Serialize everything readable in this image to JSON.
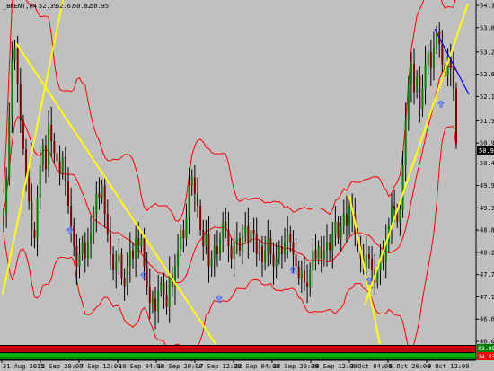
{
  "header": {
    "symbol": "_BRENT,H4",
    "open": "52.39",
    "high": "52.67",
    "low": "50.82",
    "close": "50.95"
  },
  "colors": {
    "background": "#c0c0c0",
    "bull_candle": "#008000",
    "bear_candle": "#800000",
    "wick": "#000000",
    "bands": "#ff0000",
    "trendlines": "#ffff00",
    "channel": "#0000ff",
    "price_tag_bg": "#000000",
    "indicator_tag_green": "#008000",
    "indicator_tag_red": "#ff0000"
  },
  "chart_data": {
    "type": "candlestick",
    "title": "_BRENT,H4",
    "y_ticks": [
      "54.35",
      "53.80",
      "53.20",
      "52.65",
      "52.10",
      "51.50",
      "50.95",
      "50.45",
      "49.90",
      "49.35",
      "48.80",
      "48.25",
      "47.70",
      "47.15",
      "46.60",
      "46.05"
    ],
    "x_ticks": [
      "31 Aug 2015",
      "2 Sep 20:00",
      "7 Sep 12:00",
      "10 Sep 04:00",
      "14 Sep 20:00",
      "17 Sep 12:00",
      "22 Sep 04:00",
      "24 Sep 20:00",
      "29 Sep 12:00",
      "2 Oct 04:00",
      "6 Oct 20:00",
      "9 Oct 12:00"
    ],
    "ylim": [
      46.05,
      54.6
    ],
    "current_price": "50.95",
    "indicator_values": [
      "83.8926",
      "24.8322"
    ],
    "closes": [
      49.2,
      50.1,
      51.6,
      53.0,
      53.3,
      52.4,
      51.5,
      50.8,
      50.1,
      49.5,
      48.8,
      48.6,
      49.6,
      50.4,
      50.9,
      50.3,
      51.4,
      51.0,
      50.7,
      50.5,
      50.2,
      50.6,
      50.0,
      49.4,
      48.9,
      48.4,
      47.9,
      48.2,
      48.5,
      48.1,
      48.5,
      48.7,
      49.2,
      49.7,
      49.6,
      49.9,
      49.2,
      48.7,
      48.2,
      47.8,
      48.0,
      48.2,
      47.6,
      47.4,
      47.9,
      48.3,
      48.1,
      48.6,
      48.4,
      48.6,
      47.9,
      47.4,
      47.0,
      47.1,
      46.8,
      47.3,
      47.5,
      47.2,
      46.9,
      47.7,
      47.4,
      47.9,
      48.3,
      48.8,
      48.6,
      49.1,
      49.9,
      50.1,
      49.7,
      49.4,
      48.8,
      48.4,
      48.7,
      47.9,
      48.1,
      48.4,
      48.2,
      48.6,
      49.0,
      48.8,
      48.4,
      48.1,
      48.5,
      48.6,
      48.3,
      48.7,
      48.9,
      48.5,
      48.8,
      48.7,
      48.2,
      48.4,
      48.0,
      48.3,
      48.6,
      48.2,
      47.9,
      48.1,
      48.4,
      48.2,
      48.5,
      48.7,
      48.5,
      48.2,
      47.9,
      47.6,
      47.8,
      47.5,
      47.4,
      47.8,
      48.3,
      48.1,
      48.4,
      48.1,
      48.3,
      48.5,
      48.3,
      48.7,
      49.0,
      48.6,
      48.9,
      49.2,
      48.9,
      49.4,
      49.2,
      48.7,
      48.4,
      48.1,
      47.9,
      48.2,
      48.1,
      47.8,
      47.5,
      47.8,
      48.2,
      48.0,
      48.5,
      48.9,
      49.4,
      49.3,
      49.0,
      49.3,
      50.4,
      51.5,
      52.4,
      52.9,
      52.2,
      52.6,
      51.8,
      52.3,
      52.9,
      53.2,
      52.8,
      53.3,
      53.7,
      53.4,
      52.9,
      52.6,
      53.1,
      52.8,
      52.3,
      50.95
    ]
  }
}
